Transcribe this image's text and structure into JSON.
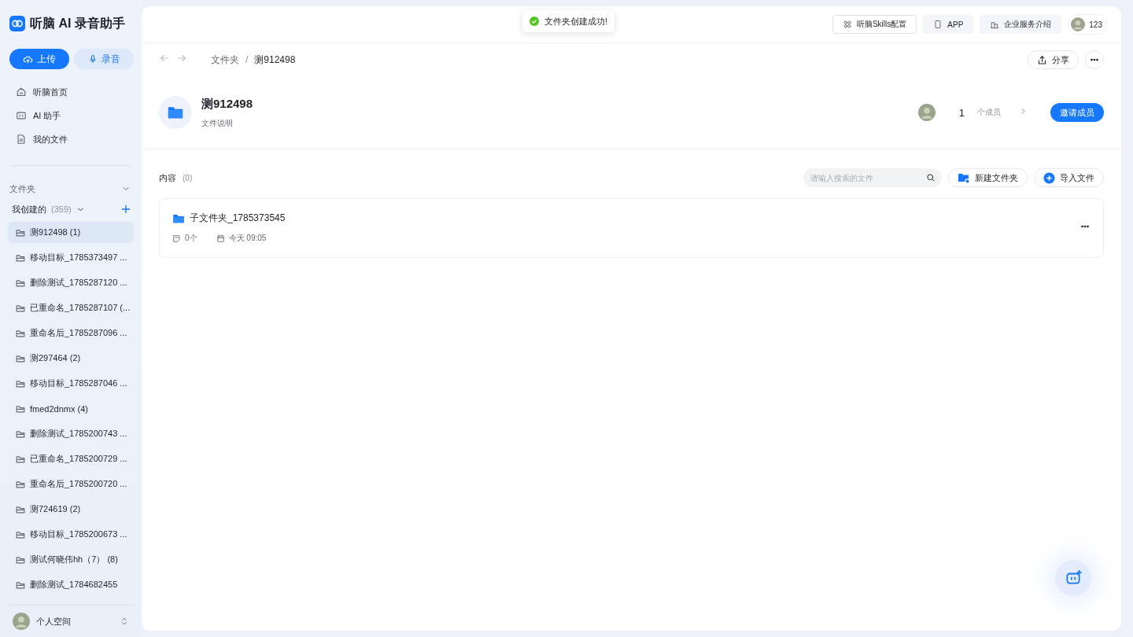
{
  "app": {
    "name": "听脑 AI 录音助手"
  },
  "sidebar": {
    "actions": [
      {
        "label": "上传",
        "kind": "primary"
      },
      {
        "label": "录音",
        "kind": "secondary"
      }
    ],
    "nav": [
      {
        "label": "听脑首页",
        "kind": "home"
      },
      {
        "label": "AI 助手",
        "kind": "assistant"
      },
      {
        "label": "我的文件",
        "kind": "files"
      }
    ],
    "section_title": "文件夹",
    "group": {
      "label": "我创建的",
      "count": "(359)"
    },
    "folders": [
      {
        "label": "测912498 (1)",
        "selected": true
      },
      {
        "label": "移动目标_1785373497 ...",
        "selected": false
      },
      {
        "label": "删除测试_1785287120 ...",
        "selected": false
      },
      {
        "label": "已重命名_1785287107 (...",
        "selected": false
      },
      {
        "label": "重命名后_1785287096 ...",
        "selected": false
      },
      {
        "label": "测297464 (2)",
        "selected": false
      },
      {
        "label": "移动目标_1785287046 ...",
        "selected": false
      },
      {
        "label": "fmed2dnmx (4)",
        "selected": false
      },
      {
        "label": "删除测试_1785200743 ...",
        "selected": false
      },
      {
        "label": "已重命名_1785200729 ...",
        "selected": false
      },
      {
        "label": "重命名后_1785200720 ...",
        "selected": false
      },
      {
        "label": "测724619 (2)",
        "selected": false
      },
      {
        "label": "移动目标_1785200673 ...",
        "selected": false
      },
      {
        "label": "测试何晓伟hh（7）  (8)",
        "selected": false
      },
      {
        "label": "删除测试_1784682455",
        "selected": false
      }
    ],
    "footer": {
      "label": "个人空间"
    }
  },
  "toast": {
    "text": "文件夹创建成功!"
  },
  "topbar": {
    "buttons": [
      {
        "label": "听脑Skills配置",
        "kind": "skills"
      },
      {
        "label": "APP",
        "kind": "app"
      },
      {
        "label": "企业服务介绍",
        "kind": "enterprise"
      }
    ],
    "user": "123"
  },
  "breadcrumb": [
    "文件夹",
    "测912498"
  ],
  "breadcrumb_separator": "/",
  "share": "分享",
  "folder": {
    "title": "测912498",
    "description": "文件说明",
    "member_count": "1",
    "member_label": "个成员",
    "invite": "邀请成员"
  },
  "content": {
    "title": "内容",
    "count": "(0)",
    "search_placeholder": "请输入搜索的文件",
    "buttons": [
      {
        "label": "新建文件夹",
        "kind": "new-folder"
      },
      {
        "label": "导入文件",
        "kind": "import"
      }
    ],
    "items": [
      {
        "name": "子文件夹_1785373545",
        "count": "0个",
        "date": "今天 09:05"
      }
    ]
  }
}
